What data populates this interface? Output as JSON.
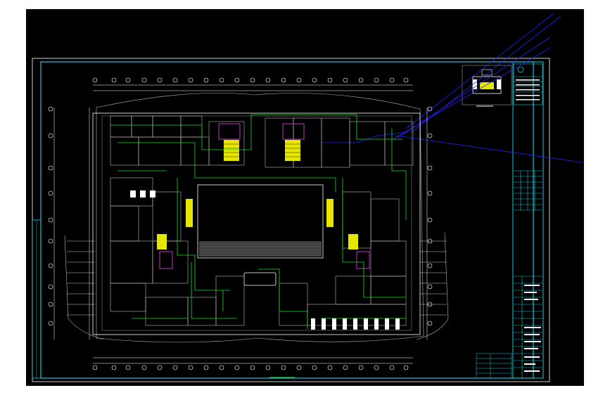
{
  "viewport": {
    "background": "#000000",
    "canvas_background": "#ffffff"
  },
  "drawing": {
    "frame_color": "#19c9d8",
    "wall_color": "#b8b8b8",
    "pipe_color": "#13e02a",
    "stair_color": "#e6e600",
    "leader_color": "#2020ff",
    "plan_caption": "",
    "logo_text": ""
  },
  "title_block": {
    "rows": [
      "",
      "",
      "",
      "",
      "",
      ""
    ]
  },
  "legend_table": {
    "rows": [
      "",
      "",
      "",
      ""
    ]
  }
}
